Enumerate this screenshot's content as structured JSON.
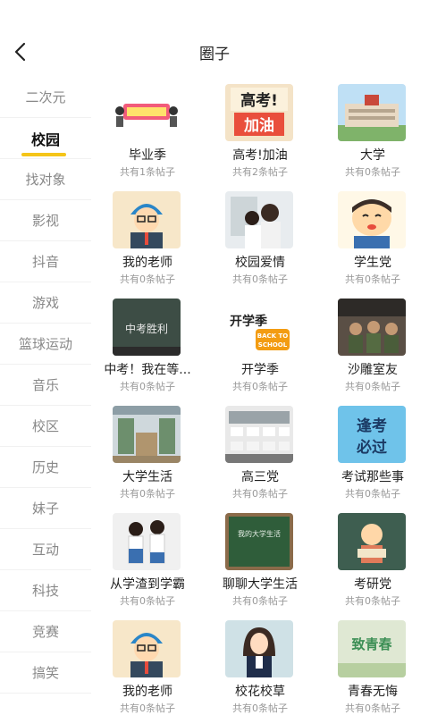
{
  "header": {
    "title": "圈子"
  },
  "sidebar": {
    "items": [
      {
        "label": "二次元"
      },
      {
        "label": "校园"
      },
      {
        "label": "找对象"
      },
      {
        "label": "影视"
      },
      {
        "label": "抖音"
      },
      {
        "label": "游戏"
      },
      {
        "label": "篮球运动"
      },
      {
        "label": "音乐"
      },
      {
        "label": "校区"
      },
      {
        "label": "历史"
      },
      {
        "label": "妹子"
      },
      {
        "label": "互动"
      },
      {
        "label": "科技"
      },
      {
        "label": "竞赛"
      },
      {
        "label": "搞笑"
      }
    ],
    "active_index": 1
  },
  "grid": {
    "items": [
      {
        "name": "毕业季",
        "count": "共有1条帖子",
        "icon": "graduation-banner-image"
      },
      {
        "name": "高考!加油",
        "count": "共有2条帖子",
        "icon": "gaokao-cheer-image",
        "thumb_text": [
          "高考!",
          "加油"
        ]
      },
      {
        "name": "大学",
        "count": "共有0条帖子",
        "icon": "university-building-image"
      },
      {
        "name": "我的老师",
        "count": "共有0条帖子",
        "icon": "teacher-cartoon-image"
      },
      {
        "name": "校园爱情",
        "count": "共有0条帖子",
        "icon": "campus-couple-image"
      },
      {
        "name": "学生党",
        "count": "共有0条帖子",
        "icon": "student-cartoon-image"
      },
      {
        "name": "中考！我在等...",
        "count": "共有0条帖子",
        "icon": "blackboard-zhongkao-image",
        "thumb_text": [
          "中考胜利"
        ]
      },
      {
        "name": "开学季",
        "count": "共有0条帖子",
        "icon": "back-to-school-image",
        "thumb_text": [
          "开学季",
          "BACK TO",
          "SCHOOL"
        ]
      },
      {
        "name": "沙雕室友",
        "count": "共有0条帖子",
        "icon": "dorm-roommates-image"
      },
      {
        "name": "大学生活",
        "count": "共有0条帖子",
        "icon": "library-image"
      },
      {
        "name": "高三党",
        "count": "共有0条帖子",
        "icon": "classroom-image"
      },
      {
        "name": "考试那些事",
        "count": "共有0条帖子",
        "icon": "exam-pass-image",
        "thumb_text": [
          "逢考",
          "必过"
        ]
      },
      {
        "name": "从学渣到学霸",
        "count": "共有0条帖子",
        "icon": "students-standing-image"
      },
      {
        "name": "聊聊大学生活",
        "count": "共有0条帖子",
        "icon": "chalkboard-image",
        "thumb_text": [
          "我的大学生活"
        ]
      },
      {
        "name": "考研党",
        "count": "共有0条帖子",
        "icon": "reading-girl-image"
      },
      {
        "name": "我的老师",
        "count": "共有0条帖子",
        "icon": "teacher-cartoon-image"
      },
      {
        "name": "校花校草",
        "count": "共有0条帖子",
        "icon": "school-girl-image"
      },
      {
        "name": "青春无悔",
        "count": "共有0条帖子",
        "icon": "youth-image",
        "thumb_text": [
          "致青春"
        ]
      }
    ]
  },
  "colors": {
    "accent": "#f5c518",
    "inactive_text": "#888888",
    "count_text": "#999999"
  }
}
